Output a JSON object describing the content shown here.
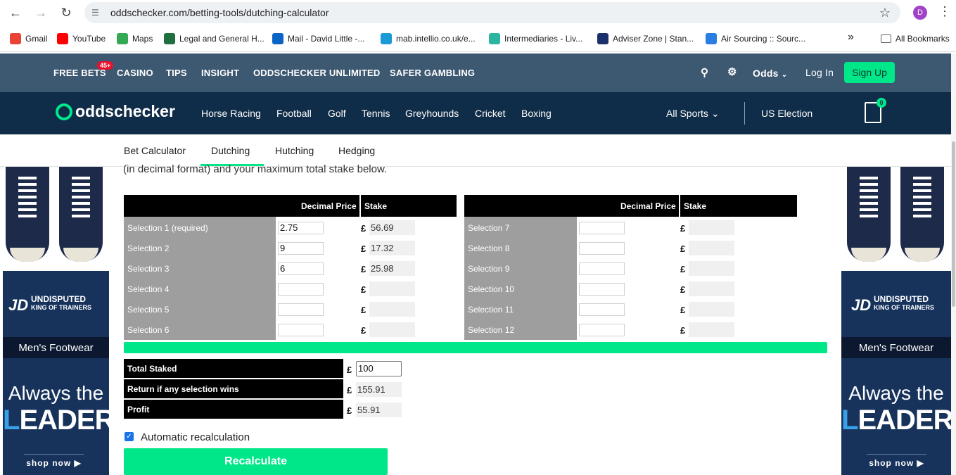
{
  "browser": {
    "url": "oddschecker.com/betting-tools/dutching-calculator",
    "profile_initial": "D",
    "bookmarks": [
      {
        "label": "Gmail",
        "icon": "gmail-icon",
        "color": "#ea4335"
      },
      {
        "label": "YouTube",
        "icon": "youtube-icon",
        "color": "#ff0000"
      },
      {
        "label": "Maps",
        "icon": "maps-icon",
        "color": "#34a853"
      },
      {
        "label": "Legal and General H...",
        "icon": "umbrella-icon",
        "color": "#1f6f3f"
      },
      {
        "label": "Mail - David Little -...",
        "icon": "outlook-icon",
        "color": "#0a64c4"
      },
      {
        "label": "mab.intellio.co.uk/e...",
        "icon": "circle-icon",
        "color": "#1b9ad6"
      },
      {
        "label": "Intermediaries - Liv...",
        "icon": "chart-icon",
        "color": "#2bb5a0"
      },
      {
        "label": "Adviser Zone | Stan...",
        "icon": "shield-icon",
        "color": "#1b2f6b"
      },
      {
        "label": "Air Sourcing :: Sourc...",
        "icon": "plane-icon",
        "color": "#2a7de1"
      }
    ],
    "all_bookmarks": "All Bookmarks",
    "overflow": "»"
  },
  "top_nav": {
    "items": [
      "FREE BETS",
      "CASINO",
      "TIPS",
      "INSIGHT",
      "ODDSCHECKER UNLIMITED",
      "SAFER GAMBLING"
    ],
    "badge": "45+",
    "odds": "Odds",
    "login": "Log In",
    "signup": "Sign Up"
  },
  "main_nav": {
    "logo": "oddschecker",
    "items": [
      "Horse Racing",
      "Football",
      "Golf",
      "Tennis",
      "Greyhounds",
      "Cricket",
      "Boxing"
    ],
    "all_sports": "All Sports",
    "us_election": "US Election",
    "betslip_count": "0"
  },
  "sub_nav": {
    "items": [
      "Bet Calculator",
      "Dutching",
      "Hutching",
      "Hedging"
    ],
    "active": "Dutching"
  },
  "ad": {
    "brand": "JD",
    "tagline": [
      "UNDISPUTED",
      "KING OF TRAINERS"
    ],
    "category": "Men's Footwear",
    "headline1": "Always the",
    "headline2_first": "L",
    "headline2_rest": "EADER",
    "cta": "shop now"
  },
  "calculator": {
    "intro": "(in decimal format) and your maximum total stake below.",
    "price_header": "Decimal Price",
    "stake_header": "Stake",
    "currency": "£",
    "left": [
      {
        "label": "Selection 1 (required)",
        "price": "2.75",
        "stake": "56.69"
      },
      {
        "label": "Selection 2",
        "price": "9",
        "stake": "17.32"
      },
      {
        "label": "Selection 3",
        "price": "6",
        "stake": "25.98"
      },
      {
        "label": "Selection 4",
        "price": "",
        "stake": ""
      },
      {
        "label": "Selection 5",
        "price": "",
        "stake": ""
      },
      {
        "label": "Selection 6",
        "price": "",
        "stake": ""
      }
    ],
    "right": [
      {
        "label": "Selection 7",
        "price": "",
        "stake": ""
      },
      {
        "label": "Selection 8",
        "price": "",
        "stake": ""
      },
      {
        "label": "Selection 9",
        "price": "",
        "stake": ""
      },
      {
        "label": "Selection 10",
        "price": "",
        "stake": ""
      },
      {
        "label": "Selection 11",
        "price": "",
        "stake": ""
      },
      {
        "label": "Selection 12",
        "price": "",
        "stake": ""
      }
    ],
    "summary": {
      "total_label": "Total Staked",
      "total_value": "100",
      "return_label": "Return if any selection wins",
      "return_value": "155.91",
      "profit_label": "Profit",
      "profit_value": "55.91"
    },
    "auto_label": "Automatic recalculation",
    "auto_checked": true,
    "recalc_label": "Recalculate"
  }
}
